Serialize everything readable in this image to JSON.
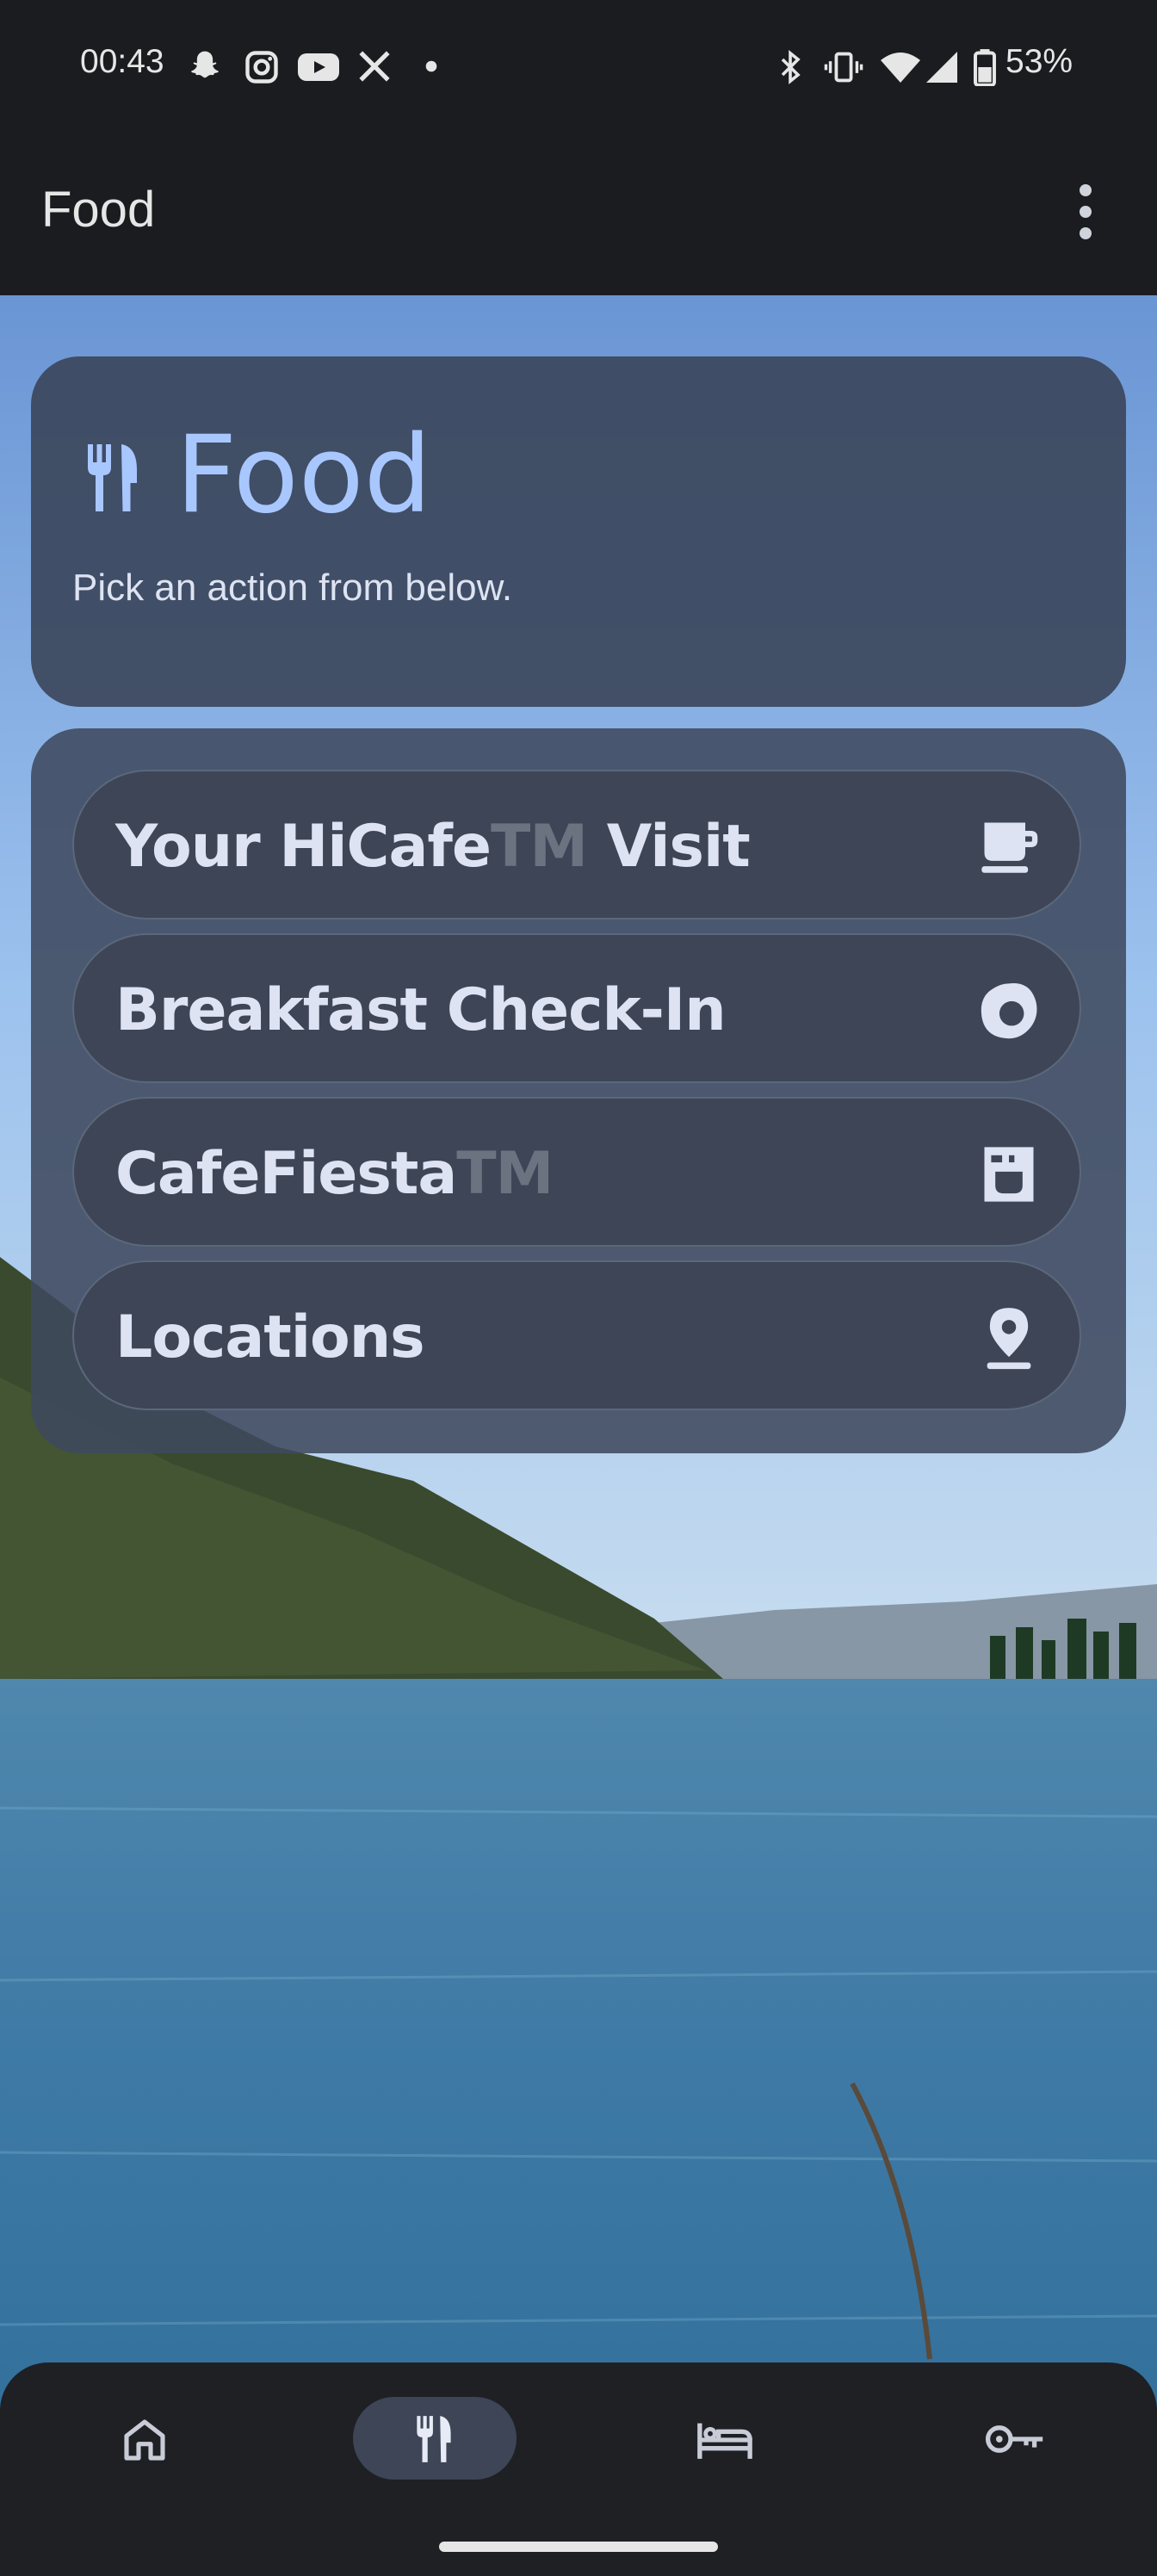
{
  "status_bar": {
    "time": "00:43",
    "battery": "53%",
    "left_icons": [
      "snapchat-icon",
      "instagram-icon",
      "youtube-icon",
      "x-icon",
      "dot-icon"
    ],
    "right_icons": [
      "bluetooth-icon",
      "vibrate-icon",
      "wifi-icon",
      "signal-icon",
      "battery-icon"
    ]
  },
  "app_bar": {
    "title": "Food"
  },
  "header": {
    "icon": "restaurant-icon",
    "title": "Food",
    "subtitle": "Pick an action from below."
  },
  "actions": [
    {
      "label": "Your HiCafe",
      "tm": "TM",
      "label_suffix": " Visit",
      "icon": "coffee-cup-icon"
    },
    {
      "label": "Breakfast Check-In",
      "icon": "egg-icon"
    },
    {
      "label": "CafeFiesta",
      "tm": "TM",
      "icon": "coffee-maker-icon"
    },
    {
      "label": "Locations",
      "icon": "location-pin-icon"
    }
  ],
  "bottom_nav": {
    "items": [
      {
        "icon": "home-icon",
        "active": false
      },
      {
        "icon": "restaurant-icon",
        "active": true
      },
      {
        "icon": "bed-icon",
        "active": false
      },
      {
        "icon": "key-icon",
        "active": false
      }
    ]
  },
  "colors": {
    "accent": "#a9c7ff",
    "card": "#3d4556",
    "bar": "#1b1c1f"
  }
}
